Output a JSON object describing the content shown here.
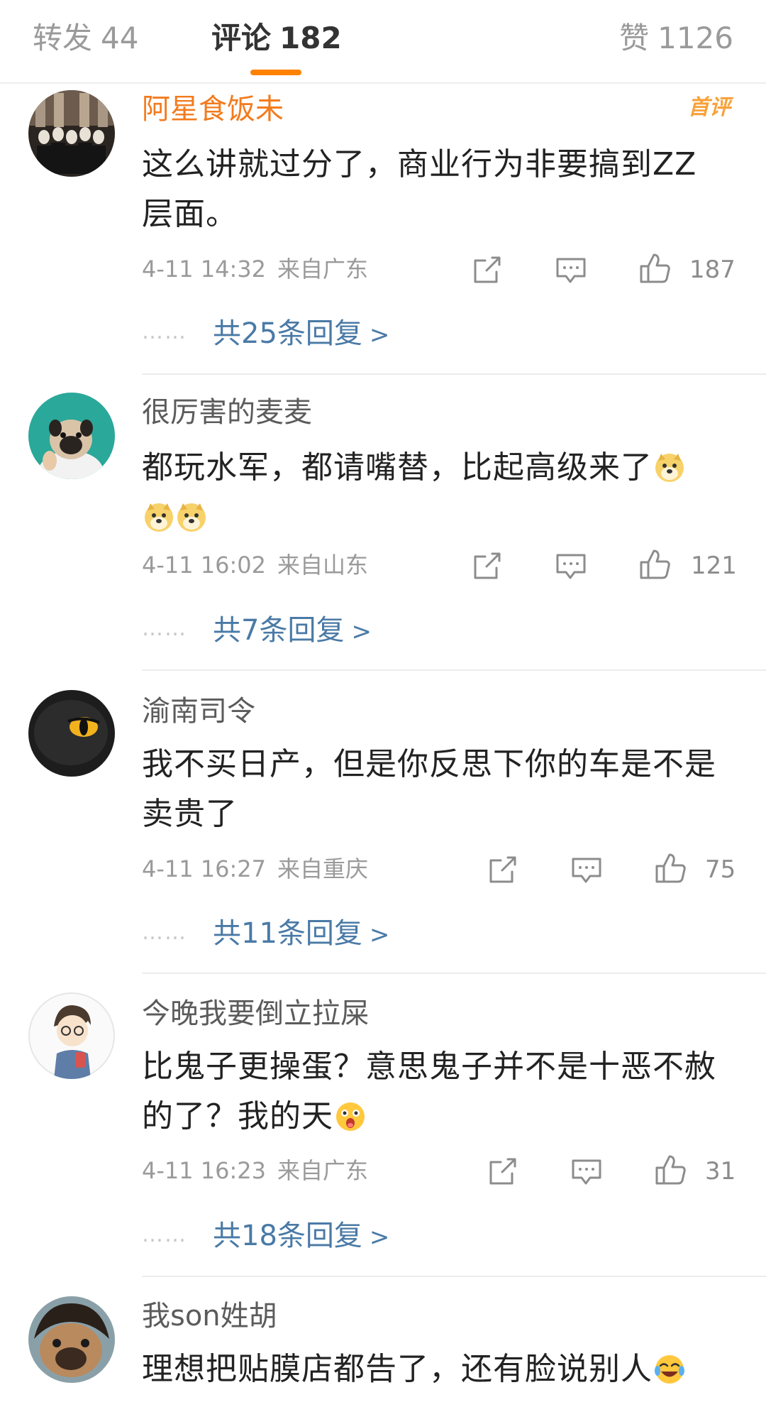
{
  "tabs": {
    "repost": {
      "label": "转发",
      "count": "44"
    },
    "comments": {
      "label": "评论",
      "count": "182"
    },
    "likes": {
      "label": "赞",
      "count": "1126"
    }
  },
  "accent_color": "#ff8200",
  "comments": [
    {
      "username": "阿星食饭未",
      "badge": "首评",
      "text": "这么讲就过分了，商业行为非要搞到ZZ层面。",
      "date": "4-11 14:32",
      "location": "来自广东",
      "likes": "187",
      "replies": "共25条回复",
      "reply_chevron": ">",
      "dots": "……"
    },
    {
      "username": "很厉害的麦麦",
      "text": "都玩水军，都请嘴替，比起高级来了",
      "emoji": "doge-emoji",
      "date": "4-11 16:02",
      "location": "来自山东",
      "likes": "121",
      "replies": "共7条回复",
      "reply_chevron": ">",
      "dots": "……"
    },
    {
      "username": "渝南司令",
      "text": "我不买日产，但是你反思下你的车是不是卖贵了",
      "date": "4-11 16:27",
      "location": "来自重庆",
      "likes": "75",
      "replies": "共11条回复",
      "reply_chevron": ">",
      "dots": "……"
    },
    {
      "username": "今晚我要倒立拉屎",
      "text": "比鬼子更操蛋？意思鬼子并不是十恶不赦的了？我的天",
      "emoji": "shocked-emoji",
      "date": "4-11 16:23",
      "location": "来自广东",
      "likes": "31",
      "replies": "共18条回复",
      "reply_chevron": ">",
      "dots": "……"
    },
    {
      "username": "我son姓胡",
      "text": "理想把贴膜店都告了，还有脸说别人",
      "emoji": "laugh-cry-emoji"
    }
  ]
}
